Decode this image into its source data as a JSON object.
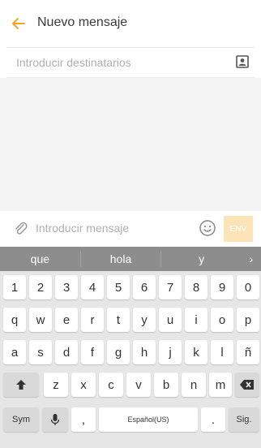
{
  "header": {
    "title": "Nuevo mensaje"
  },
  "recipient": {
    "placeholder": "Introducir destinatarios"
  },
  "compose": {
    "placeholder": "Introducir mensaje",
    "send_label": "ENV"
  },
  "suggestions": [
    "que",
    "hola",
    "y"
  ],
  "keyboard": {
    "row_numbers": [
      "1",
      "2",
      "3",
      "4",
      "5",
      "6",
      "7",
      "8",
      "9",
      "0"
    ],
    "row_q": [
      "q",
      "w",
      "e",
      "r",
      "t",
      "y",
      "u",
      "i",
      "o",
      "p"
    ],
    "row_a": [
      "a",
      "s",
      "d",
      "f",
      "g",
      "h",
      "j",
      "k",
      "l",
      "ñ"
    ],
    "row_z": [
      "z",
      "x",
      "c",
      "v",
      "b",
      "n",
      "m"
    ],
    "bottom": {
      "sym": "Sym",
      "comma": ",",
      "space": "Español(US)",
      "period": ".",
      "go": "Sig."
    }
  },
  "colors": {
    "accent": "#f5a623",
    "send_bg": "#fde3b8",
    "suggestion_bar": "#8d8d8d",
    "keyboard_bg": "#e6e6e6"
  }
}
